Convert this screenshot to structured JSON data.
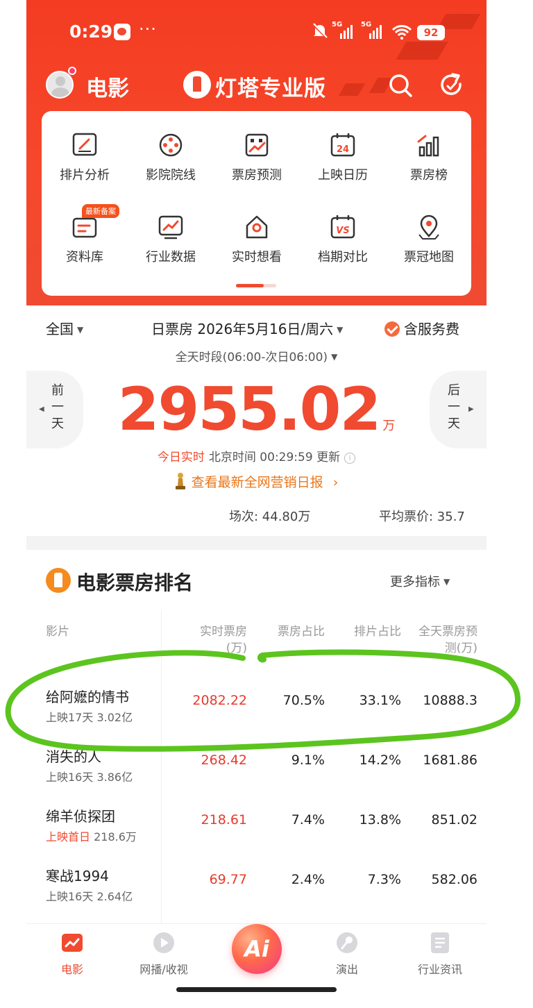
{
  "statusbar": {
    "time": "0:29",
    "dots": "···",
    "net1": "5G",
    "net2": "5G",
    "battery": "92"
  },
  "nav": {
    "title": "电影",
    "brand": "灯塔专业版"
  },
  "menu": {
    "items": [
      {
        "label": "排片分析"
      },
      {
        "label": "影院院线"
      },
      {
        "label": "票房预测"
      },
      {
        "label": "上映日历",
        "icon_text": "24"
      },
      {
        "label": "票房榜"
      },
      {
        "label": "资料库",
        "badge": "最新备案"
      },
      {
        "label": "行业数据"
      },
      {
        "label": "实时想看"
      },
      {
        "label": "档期对比",
        "icon_text": "VS"
      },
      {
        "label": "票冠地图"
      }
    ]
  },
  "daily": {
    "region": "全国",
    "date": "日票房 2026年5月16日/周六",
    "service_fee": "含服务费",
    "period": "全天时段(06:00-次日06:00)",
    "prev_day": "前一天",
    "next_day": "后一天",
    "box_office": "2955.02",
    "unit": "万",
    "live_label": "今日实时",
    "update_text": "北京时间 00:29:59 更新",
    "info_glyph": "i",
    "report_link": "查看最新全网营销日报",
    "report_arrow": "›",
    "sessions": "场次: 44.80万",
    "avg_price": "平均票价: 35.7"
  },
  "ranking": {
    "title": "电影票房排名",
    "more": "更多指标",
    "headers": {
      "film": "影片",
      "realtime_1": "实时票房",
      "realtime_2": "(万)",
      "share": "票房占比",
      "screening": "排片占比",
      "forecast_1": "全天票房预",
      "forecast_2": "测(万)"
    },
    "rows": [
      {
        "title": "给阿嬷的情书",
        "sub": "上映17天 3.02亿",
        "realtime": "2082.22",
        "share": "70.5%",
        "screening": "33.1%",
        "forecast": "10888.3"
      },
      {
        "title": "消失的人",
        "sub": "上映16天 3.86亿",
        "realtime": "268.42",
        "share": "9.1%",
        "screening": "14.2%",
        "forecast": "1681.86"
      },
      {
        "title": "绵羊侦探团",
        "sub_first": "上映首日",
        "sub": "218.6万",
        "realtime": "218.61",
        "share": "7.4%",
        "screening": "13.8%",
        "forecast": "851.02"
      },
      {
        "title": "寒战1994",
        "sub": "上映16天 2.64亿",
        "realtime": "69.77",
        "share": "2.4%",
        "screening": "7.3%",
        "forecast": "582.06"
      }
    ]
  },
  "tabbar": {
    "tabs": [
      {
        "label": "电影"
      },
      {
        "label": "网播/收视"
      },
      {
        "label": "演出"
      },
      {
        "label": "行业资讯"
      }
    ],
    "ai_label": "Ai"
  },
  "colors": {
    "brand_red": "#f04a30",
    "annotation_green": "#5cc41e",
    "orange": "#e9761a"
  }
}
